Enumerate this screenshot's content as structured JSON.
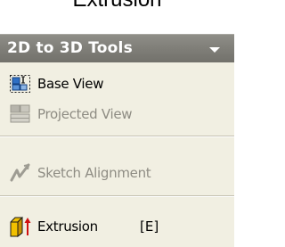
{
  "caption": "Extrusion",
  "panel": {
    "title": "2D to 3D Tools",
    "title_icon": "chevron-down-icon"
  },
  "tools": [
    {
      "label": "Base View",
      "icon": "base-view-icon",
      "enabled": true
    },
    {
      "label": "Projected View",
      "icon": "projected-view-icon",
      "enabled": false
    },
    {
      "label": "Sketch Alignment",
      "icon": "sketch-alignment-icon",
      "enabled": false
    },
    {
      "label": "Extrusion",
      "shortcut": "[E]",
      "icon": "extrusion-icon",
      "enabled": true
    }
  ],
  "colors": {
    "header_background": "#7e7d77",
    "panel_background": "#f1efe2",
    "disabled_text": "#8e8c83",
    "icon_blue": "#2f6fc4",
    "icon_gold": "#e8a400",
    "icon_red": "#d01010"
  }
}
